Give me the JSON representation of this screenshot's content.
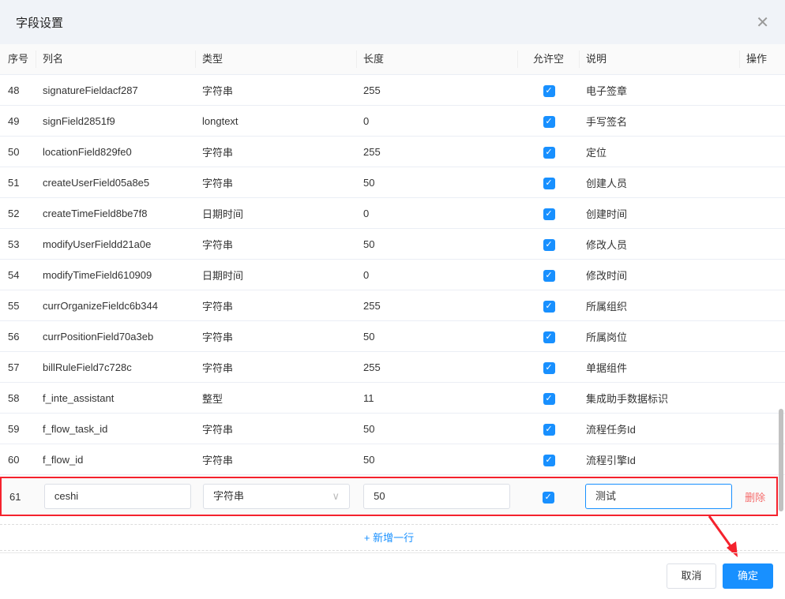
{
  "dialog": {
    "title": "字段设置"
  },
  "columns": [
    "序号",
    "列名",
    "类型",
    "长度",
    "允许空",
    "说明",
    "操作"
  ],
  "rows": [
    {
      "seq": "48",
      "name": "signatureFieldacf287",
      "type": "字符串",
      "length": "255",
      "desc": "电子签章"
    },
    {
      "seq": "49",
      "name": "signField2851f9",
      "type": "longtext",
      "length": "0",
      "desc": "手写签名"
    },
    {
      "seq": "50",
      "name": "locationField829fe0",
      "type": "字符串",
      "length": "255",
      "desc": "定位"
    },
    {
      "seq": "51",
      "name": "createUserField05a8e5",
      "type": "字符串",
      "length": "50",
      "desc": "创建人员"
    },
    {
      "seq": "52",
      "name": "createTimeField8be7f8",
      "type": "日期时间",
      "length": "0",
      "desc": "创建时间"
    },
    {
      "seq": "53",
      "name": "modifyUserFieldd21a0e",
      "type": "字符串",
      "length": "50",
      "desc": "修改人员"
    },
    {
      "seq": "54",
      "name": "modifyTimeField610909",
      "type": "日期时间",
      "length": "0",
      "desc": "修改时间"
    },
    {
      "seq": "55",
      "name": "currOrganizeFieldc6b344",
      "type": "字符串",
      "length": "255",
      "desc": "所属组织"
    },
    {
      "seq": "56",
      "name": "currPositionField70a3eb",
      "type": "字符串",
      "length": "50",
      "desc": "所属岗位"
    },
    {
      "seq": "57",
      "name": "billRuleField7c728c",
      "type": "字符串",
      "length": "255",
      "desc": "单据组件"
    },
    {
      "seq": "58",
      "name": "f_inte_assistant",
      "type": "整型",
      "length": "11",
      "desc": "集成助手数据标识"
    },
    {
      "seq": "59",
      "name": "f_flow_task_id",
      "type": "字符串",
      "length": "50",
      "desc": "流程任务Id"
    },
    {
      "seq": "60",
      "name": "f_flow_id",
      "type": "字符串",
      "length": "50",
      "desc": "流程引擎Id"
    }
  ],
  "edit_row": {
    "seq": "61",
    "name": "ceshi",
    "type": "字符串",
    "length": "50",
    "desc": "测试",
    "delete": "删除"
  },
  "add_row": "+ 新增一行",
  "footer": {
    "cancel": "取消",
    "ok": "确定"
  }
}
